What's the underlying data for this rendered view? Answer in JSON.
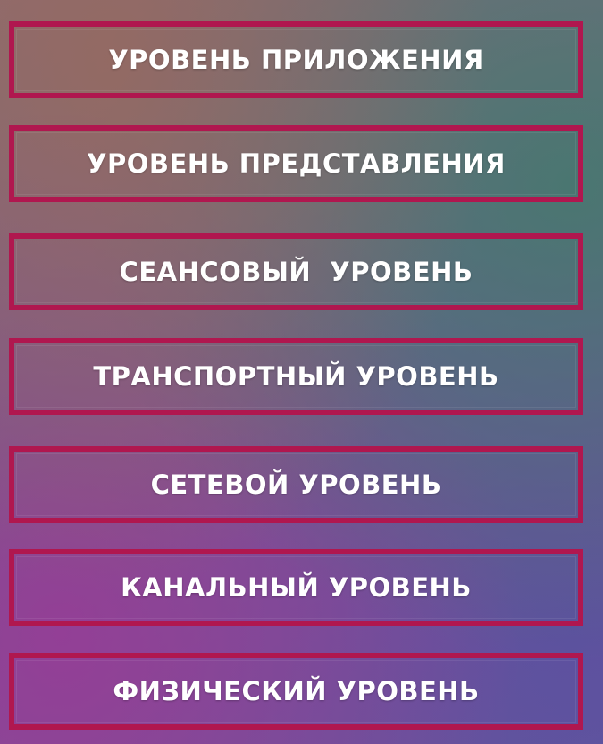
{
  "colors": {
    "frame": "#b0174f",
    "text": "#ffffff"
  },
  "layers": [
    {
      "label": "УРОВЕНЬ ПРИЛОЖЕНИЯ"
    },
    {
      "label": "УРОВЕНЬ ПРЕДСТАВЛЕНИЯ"
    },
    {
      "label": "СЕАНСОВЫЙ  УРОВЕНЬ"
    },
    {
      "label": "ТРАНСПОРТНЫЙ УРОВЕНЬ"
    },
    {
      "label": "СЕТЕВОЙ УРОВЕНЬ"
    },
    {
      "label": "КАНАЛЬНЫЙ УРОВЕНЬ"
    },
    {
      "label": "ФИЗИЧЕСКИЙ УРОВЕНЬ"
    }
  ]
}
